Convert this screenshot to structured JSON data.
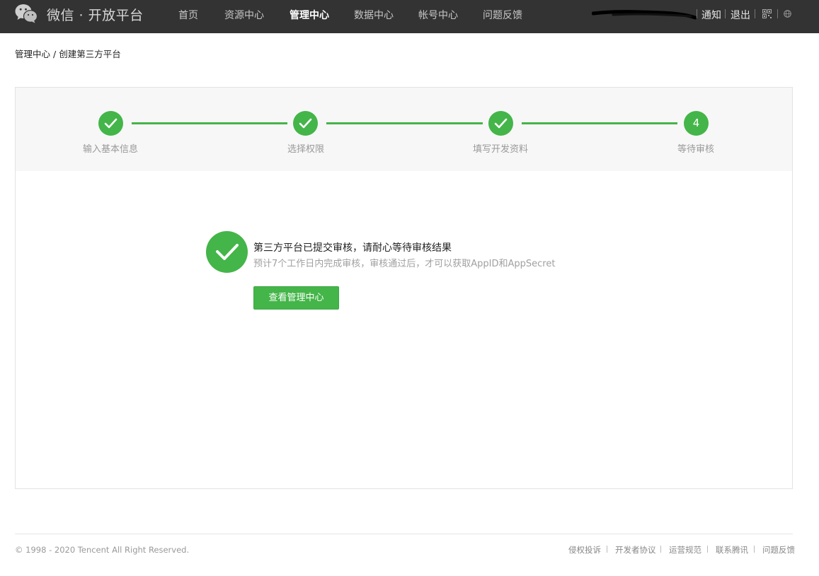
{
  "header": {
    "brand": "微信 · 开放平台",
    "nav": [
      {
        "label": "首页",
        "active": false
      },
      {
        "label": "资源中心",
        "active": false
      },
      {
        "label": "管理中心",
        "active": true
      },
      {
        "label": "数据中心",
        "active": false
      },
      {
        "label": "帐号中心",
        "active": false
      },
      {
        "label": "问题反馈",
        "active": false
      }
    ],
    "notify_label": "通知",
    "logout_label": "退出",
    "icons": [
      "wechat-logo-icon",
      "qr-code-icon",
      "globe-icon"
    ]
  },
  "breadcrumb": {
    "parent": "管理中心",
    "separator": " / ",
    "current": "创建第三方平台"
  },
  "steps": [
    {
      "label": "输入基本信息",
      "status": "done"
    },
    {
      "label": "选择权限",
      "status": "done"
    },
    {
      "label": "填写开发资料",
      "status": "done"
    },
    {
      "label": "等待审核",
      "status": "current",
      "number": "4"
    }
  ],
  "result": {
    "title": "第三方平台已提交审核，请耐心等待审核结果",
    "description": "预计7个工作日内完成审核，审核通过后，才可以获取AppID和AppSecret",
    "button_label": "查看管理中心"
  },
  "footer": {
    "copyright": "© 1998 - 2020 Tencent All Right Reserved.",
    "links": [
      "侵权投诉",
      "开发者协议",
      "运营规范",
      "联系腾讯",
      "问题反馈"
    ]
  },
  "colors": {
    "topbar": "#333333",
    "accent": "#44b549",
    "step_bg": "#f7f7f7"
  }
}
